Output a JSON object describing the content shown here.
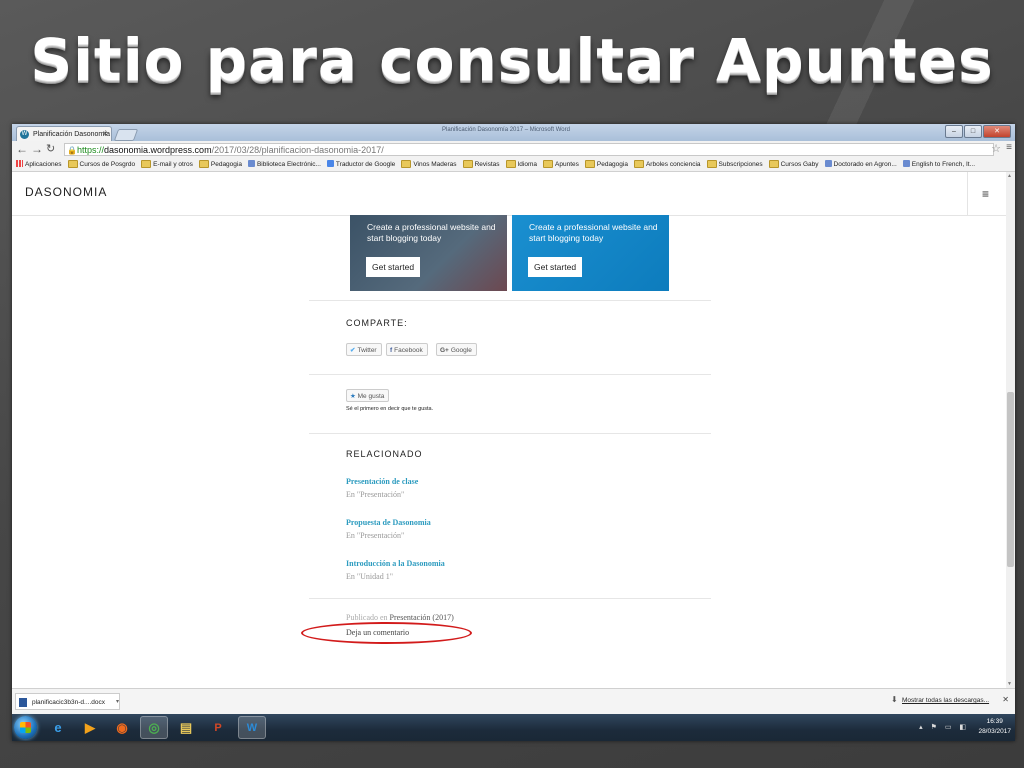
{
  "slide": {
    "title": "Sitio para consultar Apuntes"
  },
  "browser": {
    "tab_title": "Planificación Dasonomía",
    "window_title": "Planificación Dasonomía 2017 – Microsoft Word",
    "url_protocol": "https://",
    "url_host": "dasonomia.wordpress.com",
    "url_path": "/2017/03/28/planificacion-dasonomia-2017/"
  },
  "bookmarks": [
    {
      "label": "Aplicaciones",
      "icon": "apps-icon"
    },
    {
      "label": "Cursos de Posgrdo",
      "icon": "folder-icon"
    },
    {
      "label": "E-mail y otros",
      "icon": "folder-icon"
    },
    {
      "label": "Pedagogia",
      "icon": "folder-icon"
    },
    {
      "label": "Biblioteca Electrónic...",
      "icon": "bookmark-icon"
    },
    {
      "label": "Traductor de Google",
      "icon": "translate-icon"
    },
    {
      "label": "Vinos Maderas",
      "icon": "folder-icon"
    },
    {
      "label": "Revistas",
      "icon": "folder-icon"
    },
    {
      "label": "Idioma",
      "icon": "folder-icon"
    },
    {
      "label": "Apuntes",
      "icon": "folder-icon"
    },
    {
      "label": "Pedagogia",
      "icon": "folder-icon"
    },
    {
      "label": "Arboles conciencia",
      "icon": "folder-icon"
    },
    {
      "label": "Subscripciones",
      "icon": "folder-icon"
    },
    {
      "label": "Cursos Gaby",
      "icon": "folder-icon"
    },
    {
      "label": "Doctorado en Agron...",
      "icon": "bookmark-icon"
    },
    {
      "label": "English to French, It...",
      "icon": "bookmark-icon"
    }
  ],
  "site": {
    "title": "DASONOMIA",
    "promo_left": {
      "text": "Create a professional website and start blogging today",
      "button": "Get started"
    },
    "promo_right": {
      "text": "Create a professional website and start blogging today",
      "button": "Get started"
    },
    "share_heading": "COMPARTE:",
    "share_buttons": [
      "Twitter",
      "Facebook",
      "Google"
    ],
    "like_button": "Me gusta",
    "like_note": "Sé el primero en decir que te gusta.",
    "related_heading": "RELACIONADO",
    "related": [
      {
        "title": "Presentación de clase",
        "category": "En \"Presentación\""
      },
      {
        "title": "Propuesta de Dasonomia",
        "category": "En \"Presentación\""
      },
      {
        "title": "Introducción a la Dasonomia",
        "category": "En \"Unidad 1\""
      }
    ],
    "published_prefix": "Publicado en",
    "published_category": "Presentación (2017)",
    "comment_link": "Deja un comentario"
  },
  "downloads": {
    "file": "planificacic3b3n-d....docx",
    "show_all": "Mostrar todas las descargas..."
  },
  "taskbar": {
    "time": "16:39",
    "date": "28/03/2017"
  },
  "colors": {
    "accent_link": "#2c9bbf",
    "promo_blue": "#1a8fd0",
    "annotation_red": "#d21b1b"
  }
}
